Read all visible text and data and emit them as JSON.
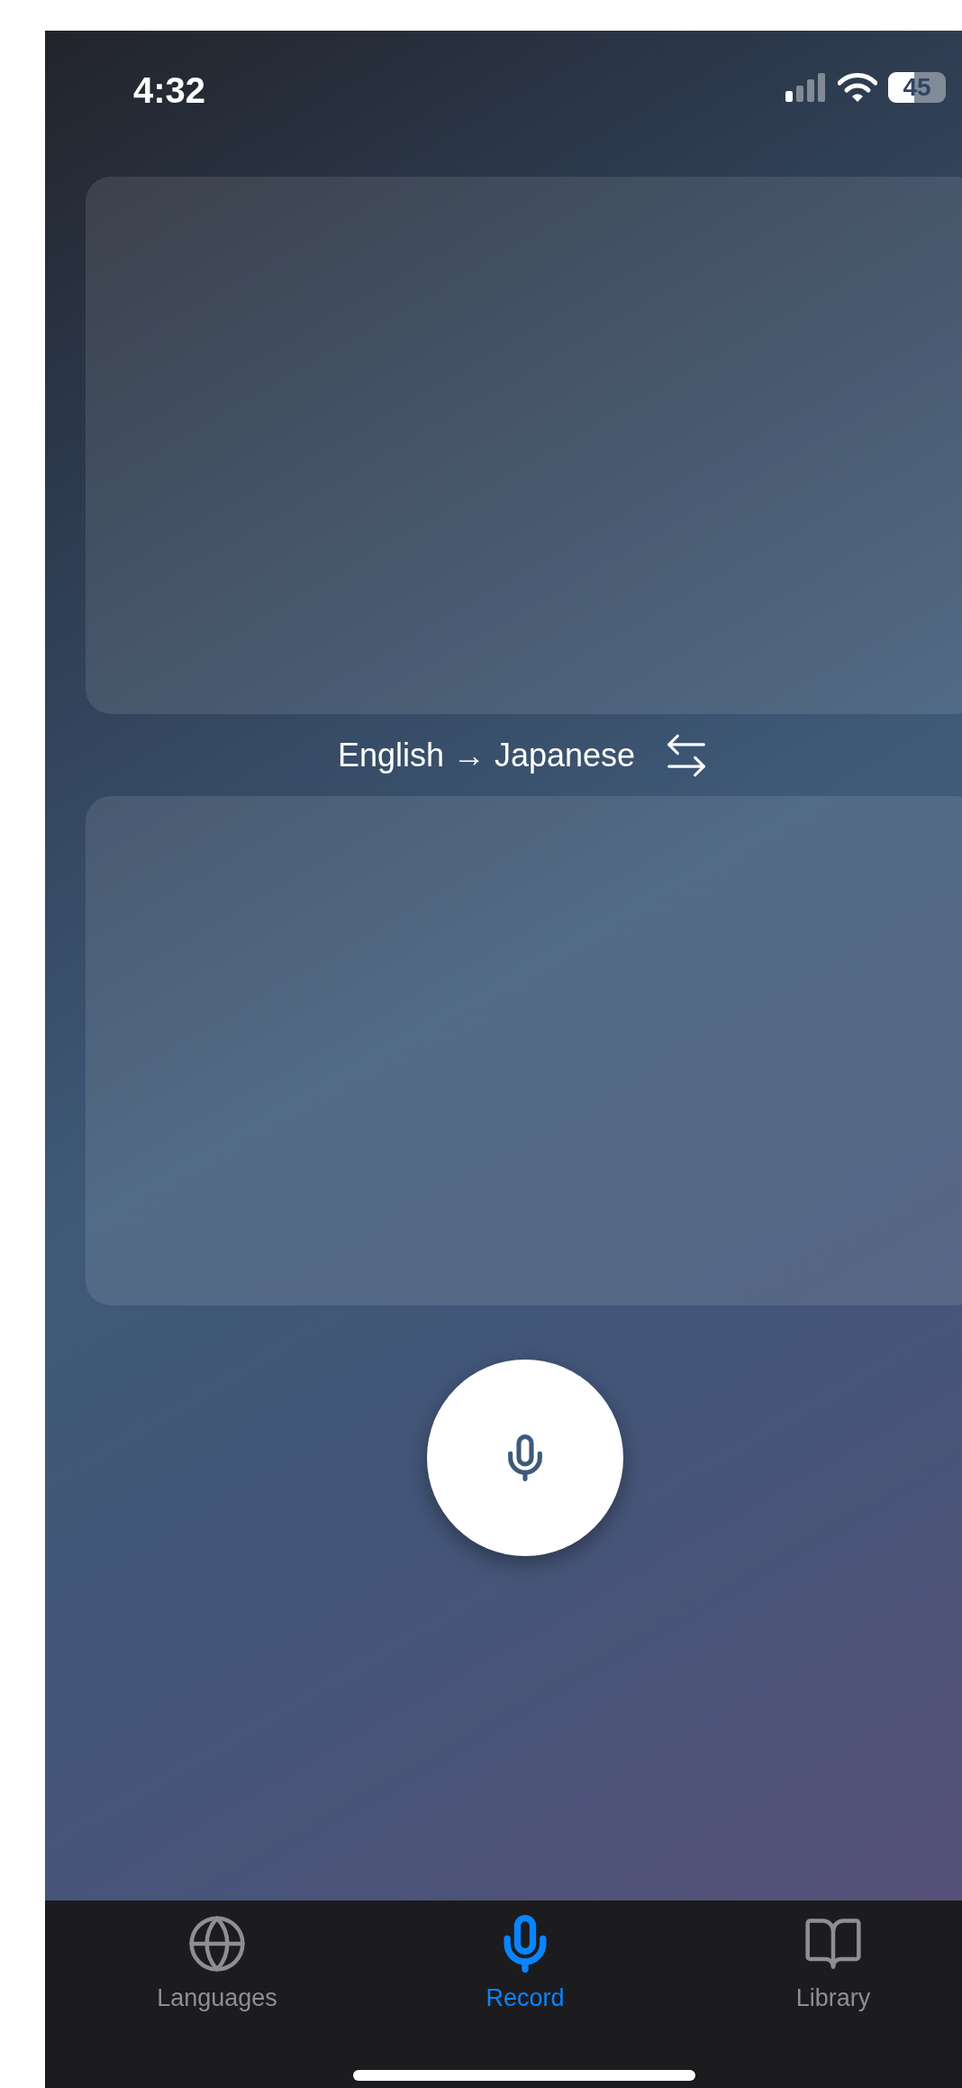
{
  "status_bar": {
    "time": "4:32",
    "battery": "45"
  },
  "language_pair": {
    "label": "English → Japanese"
  },
  "tabs": [
    {
      "label": "Languages",
      "selected": false
    },
    {
      "label": "Record",
      "selected": true
    },
    {
      "label": "Library",
      "selected": false
    }
  ]
}
